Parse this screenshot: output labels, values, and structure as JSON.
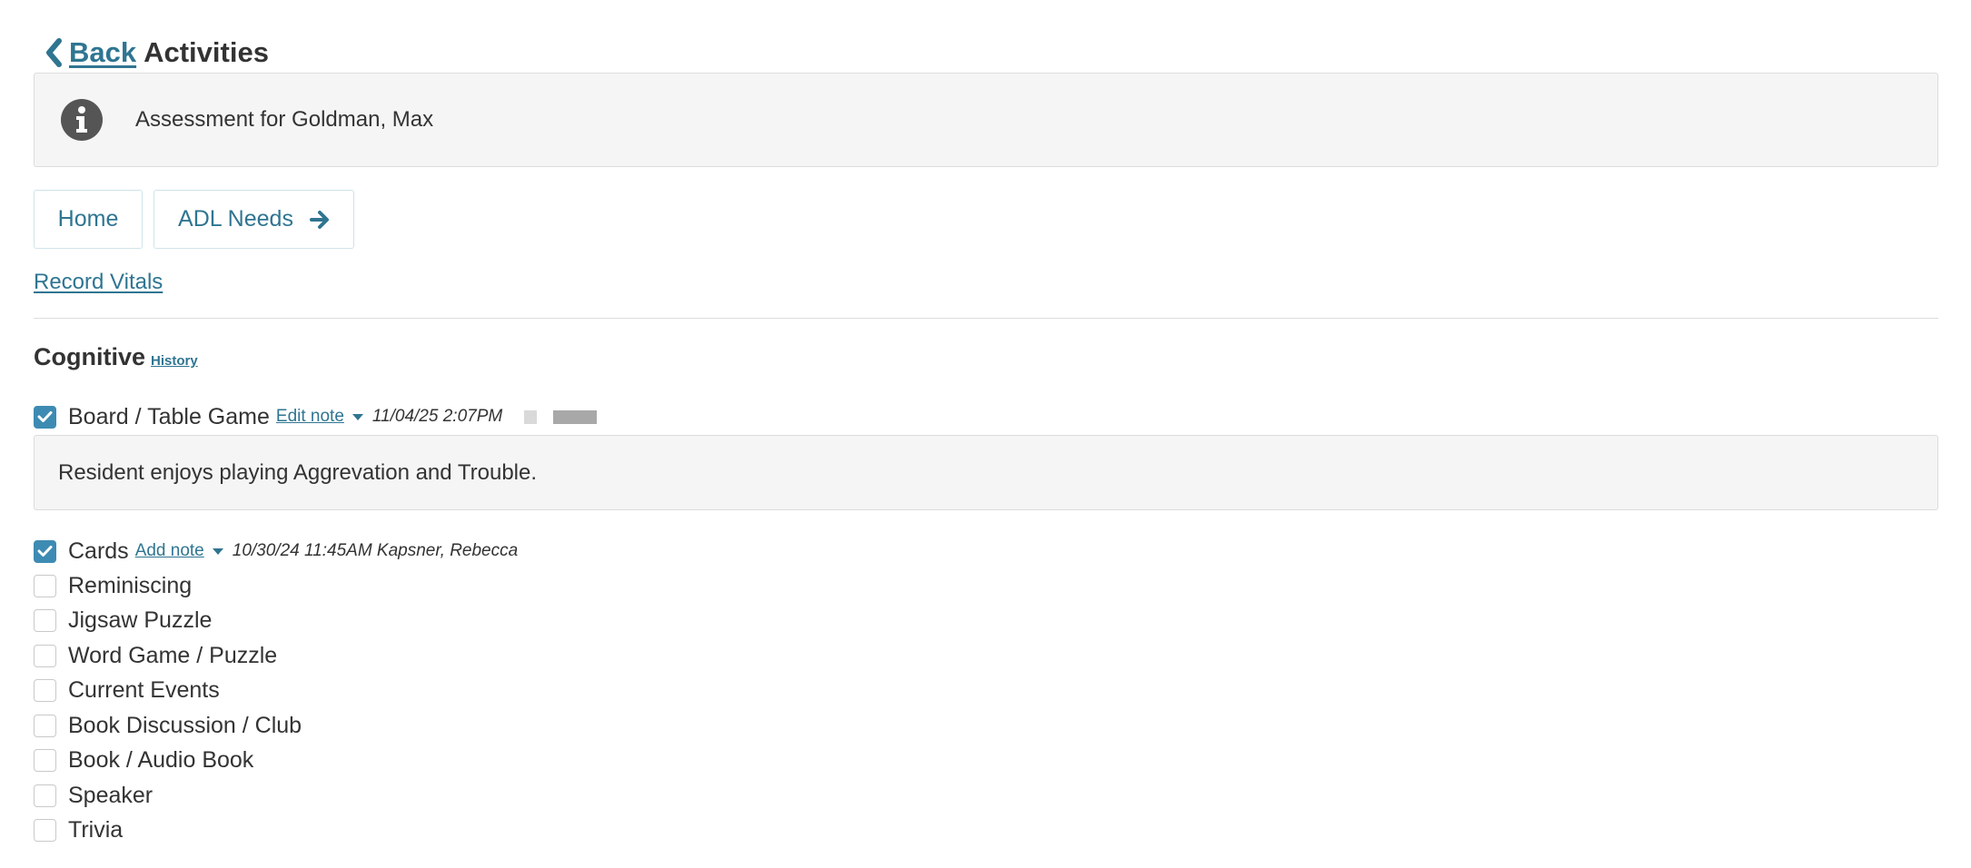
{
  "header": {
    "back_label": "Back",
    "title": "Activities"
  },
  "info": {
    "icon": "info-circle-icon",
    "text": "Assessment for Goldman, Max"
  },
  "nav": {
    "home_label": "Home",
    "next_label": "ADL Needs",
    "next_icon": "arrow-right-icon"
  },
  "record_vitals_label": "Record Vitals",
  "section": {
    "title": "Cognitive",
    "history_label": "History"
  },
  "activities": [
    {
      "label": "Board / Table Game",
      "checked": true,
      "note_action": "Edit note",
      "meta": "11/04/25 2:07PM",
      "note": "Resident enjoys playing Aggrevation and Trouble."
    },
    {
      "label": "Cards",
      "checked": true,
      "note_action": "Add note",
      "meta": "10/30/24 11:45AM Kapsner, Rebecca"
    },
    {
      "label": "Reminiscing",
      "checked": false
    },
    {
      "label": "Jigsaw Puzzle",
      "checked": false
    },
    {
      "label": "Word Game / Puzzle",
      "checked": false
    },
    {
      "label": "Current Events",
      "checked": false
    },
    {
      "label": "Book Discussion / Club",
      "checked": false
    },
    {
      "label": "Book / Audio Book",
      "checked": false
    },
    {
      "label": "Speaker",
      "checked": false
    },
    {
      "label": "Trivia",
      "checked": false
    }
  ],
  "colors": {
    "link": "#2f7591",
    "checkbox_checked": "#3d8bb3",
    "panel_bg": "#f5f5f5"
  }
}
